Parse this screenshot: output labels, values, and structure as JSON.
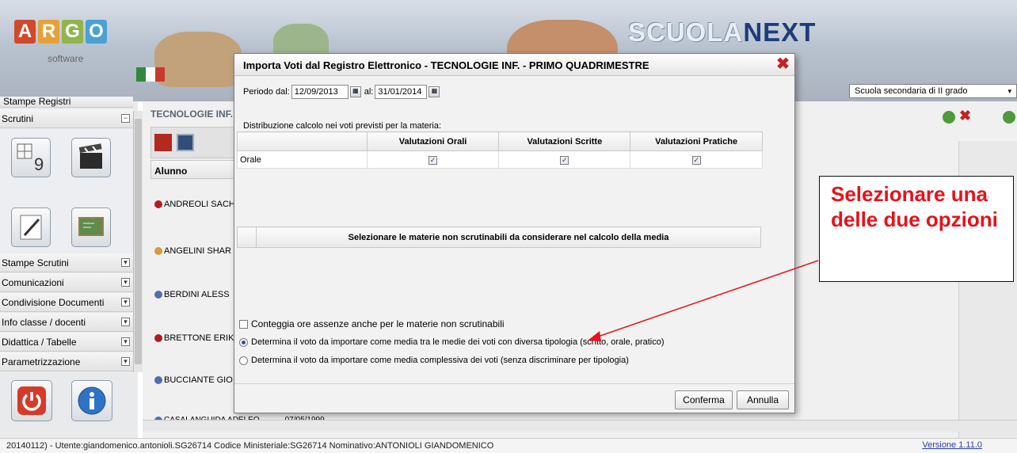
{
  "banner": {
    "logo_letters": [
      "A",
      "R",
      "G",
      "O"
    ],
    "logo_colors": [
      "#d04a29",
      "#e8a136",
      "#91b54b",
      "#4aa1d5"
    ],
    "logo_sub": "software",
    "product_part1": "SCUOLA",
    "product_part2": "NEXT",
    "school_select": "Scuola secondaria di II grado"
  },
  "sidebar": {
    "cut_top_item": "Stampe Registri",
    "scrutini": "Scrutini",
    "items": [
      "Stampe Scrutini",
      "Comunicazioni",
      "Condivisione Documenti",
      "Info classe / docenti",
      "Didattica / Tabelle",
      "Parametrizzazione"
    ],
    "tile_icons": [
      "grid-grades-icon",
      "clapperboard-icon",
      "pencil-icon",
      "chalkboard-icon"
    ],
    "bottom_icons": [
      "power-icon",
      "info-icon"
    ]
  },
  "main": {
    "panel_title": "TECNOLOGIE INF.",
    "col_alunno": "Alunno",
    "students": [
      {
        "name": "ANDREOLI SACH",
        "color": "#b01e1e"
      },
      {
        "name": "ANGELINI SHAR",
        "color": "#d99a3a"
      },
      {
        "name": "BERDINI ALESS",
        "color": "#4d6fb0"
      },
      {
        "name": "BRETTONE ERIK",
        "color": "#b01e1e"
      },
      {
        "name": "BUCCIANTE GIO",
        "color": "#4d6fb0"
      },
      {
        "name": "CASALANGUIDA ADELEO",
        "color": "#4d6fb0"
      }
    ],
    "last_date": "07/05/1999"
  },
  "dialog": {
    "title": "Importa Voti dal Registro Elettronico - TECNOLOGIE INF. - PRIMO QUADRIMESTRE",
    "periodo_label": "Periodo dal:",
    "date_from": "12/09/2013",
    "al_label": "al:",
    "date_to": "31/01/2014",
    "distribuzione_label": "Distribuzione calcolo nei voti previsti per la materia:",
    "columns": [
      "",
      "Valutazioni Orali",
      "Valutazioni Scritte",
      "Valutazioni Pratiche"
    ],
    "rows": [
      {
        "name": "Orale",
        "orali": true,
        "scritte": true,
        "pratiche": true
      }
    ],
    "materie_header": "Selezionare le materie non scrutinabili da considerare nel calcolo della media",
    "conteggia_label": "Conteggia ore assenze anche per le materie non scrutinabili",
    "conteggia_checked": false,
    "option1": "Determina il voto da importare come media tra le medie dei voti con diversa tipologia (scritto, orale, pratico)",
    "option2": "Determina il voto da importare come media complessiva dei voti (senza discriminare per tipologia)",
    "selected_option": 1,
    "confirm": "Conferma",
    "cancel": "Annulla"
  },
  "annotation": {
    "text": "Selezionare una delle due opzioni",
    "color": "#e3141b"
  },
  "status_bar": {
    "text": "20140112) - Utente:giandomenico.antonioli.SG26714 Codice Ministeriale:SG26714 Nominativo:ANTONIOLI GIANDOMENICO",
    "version": "Versione 1.11.0"
  }
}
